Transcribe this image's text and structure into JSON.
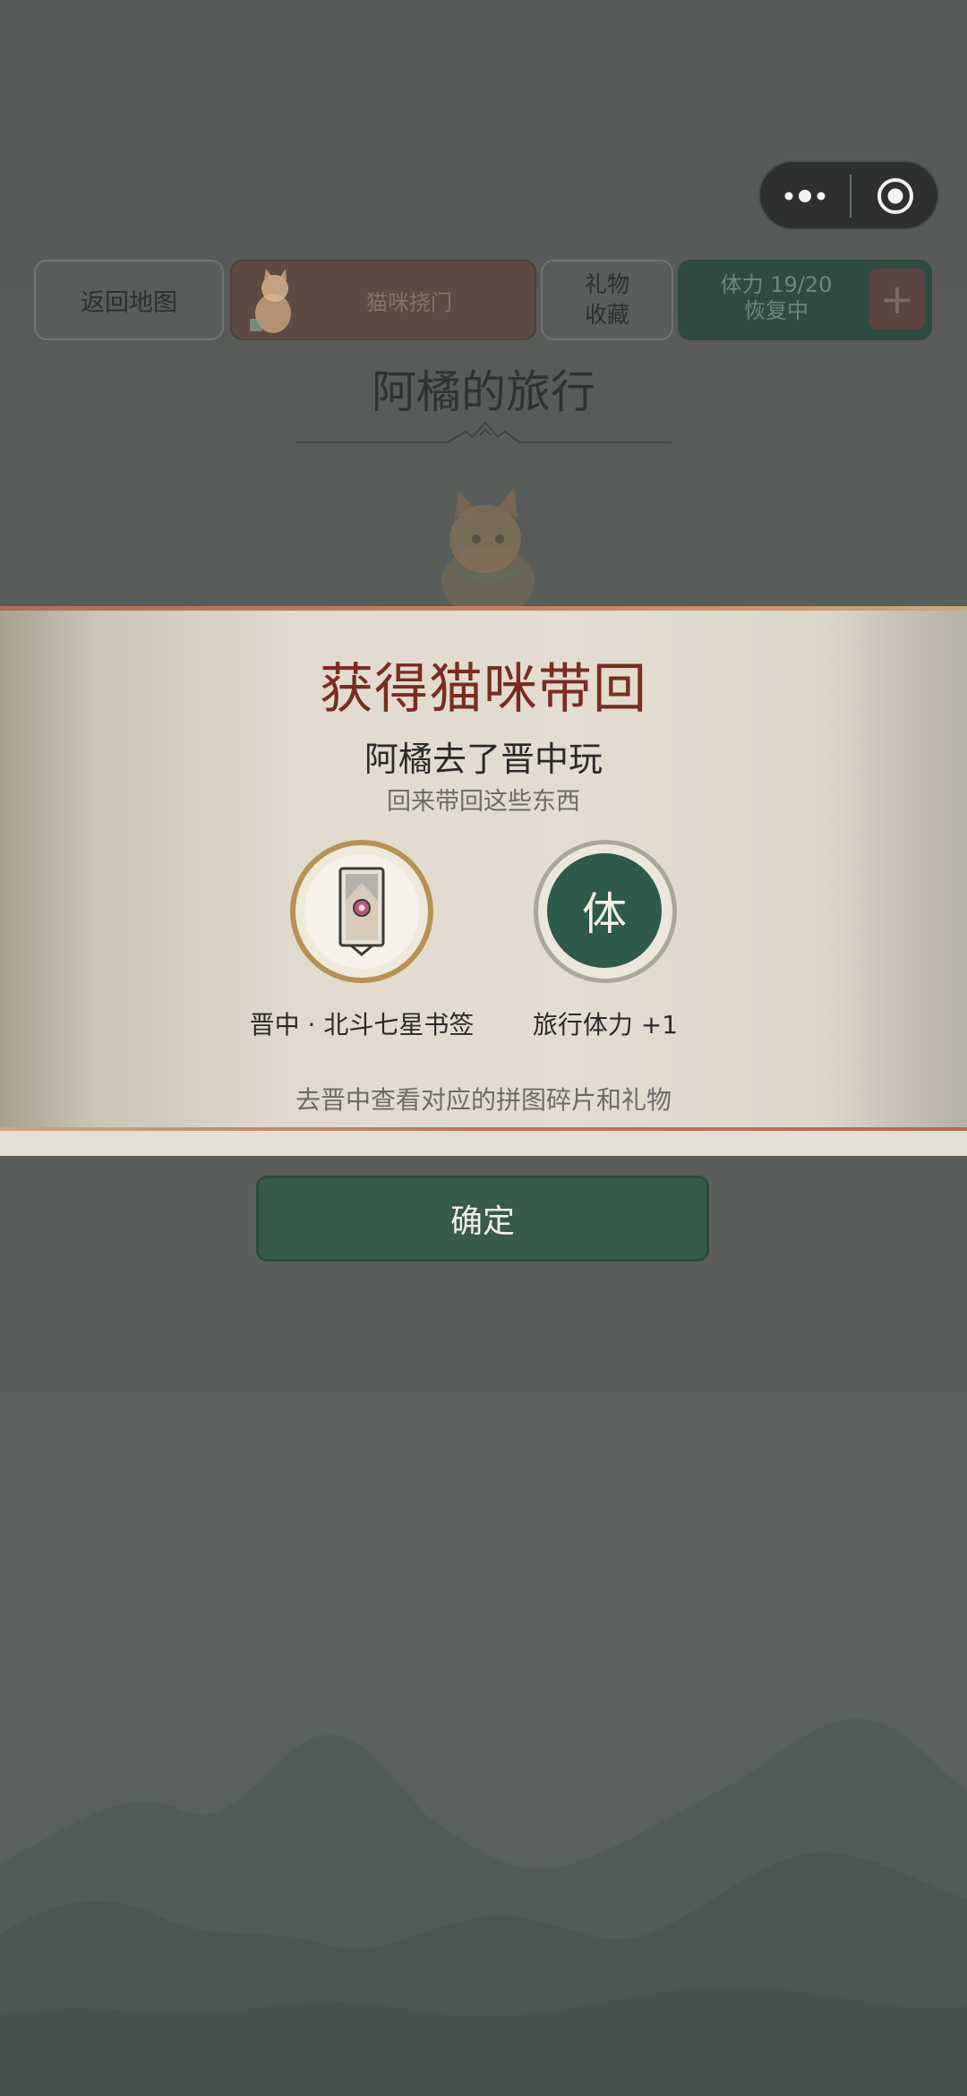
{
  "topbar": {
    "back_label": "返回地图",
    "cat_label": "猫咪挠门",
    "gift_line1": "礼物",
    "gift_line2": "收藏",
    "stamina_line1": "体力 19/20",
    "stamina_line2": "恢复中",
    "plus_label": "+"
  },
  "page": {
    "title": "阿橘的旅行"
  },
  "modal": {
    "title": "获得猫咪带回",
    "subtitle": "阿橘去了晋中玩",
    "subtitle2": "回来带回这些东西",
    "items": [
      {
        "label": "晋中 · 北斗七星书签",
        "icon": "bookmark-icon"
      },
      {
        "label": "旅行体力 +1",
        "icon_text": "体"
      }
    ],
    "hint": "去晋中查看对应的拼图碎片和礼物",
    "confirm_label": "确定"
  },
  "colors": {
    "modal_title": "#7a2c22",
    "confirm_bg": "#375a4b",
    "stamina_icon_bg": "#2d5a4a",
    "bookmark_ring": "#b79256"
  }
}
